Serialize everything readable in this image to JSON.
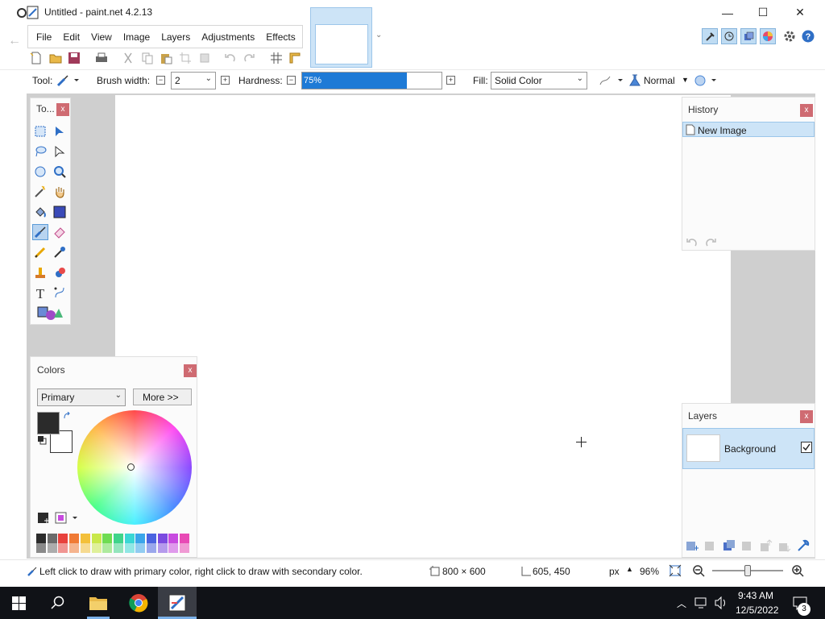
{
  "window": {
    "title": "Untitled - paint.net 4.2.13",
    "minimize": "—",
    "maximize": "☐",
    "close": "✕"
  },
  "menu": [
    "File",
    "Edit",
    "View",
    "Image",
    "Layers",
    "Adjustments",
    "Effects"
  ],
  "toolbar": {
    "tool_label": "Tool:",
    "brush_width_label": "Brush width:",
    "brush_width_value": "2",
    "hardness_label": "Hardness:",
    "hardness_value": "75%",
    "hardness_fraction": 0.75,
    "fill_label": "Fill:",
    "fill_value": "Solid Color",
    "blend_mode": "Normal"
  },
  "tools_panel": {
    "title": "To...",
    "close": "x"
  },
  "history_panel": {
    "title": "History",
    "close": "x",
    "items": [
      "New Image"
    ]
  },
  "layers_panel": {
    "title": "Layers",
    "close": "x",
    "items": [
      {
        "name": "Background",
        "visible": true
      }
    ]
  },
  "colors_panel": {
    "title": "Colors",
    "close": "x",
    "mode": "Primary",
    "more_button": "More >>",
    "primary_color": "#2b2b2b",
    "secondary_color": "#ffffff"
  },
  "palette": [
    "#2b2b2b",
    "#6b6b6b",
    "#e8413c",
    "#f07a35",
    "#f3c03a",
    "#c9e84a",
    "#6fdc52",
    "#3fd48a",
    "#3ad7d4",
    "#3aa5ea",
    "#4a63e0",
    "#7b4ae0",
    "#c84ae0",
    "#e84ab5"
  ],
  "status": {
    "hint": "Left click to draw with primary color, right click to draw with secondary color.",
    "image_size": "800 × 600",
    "cursor_pos": "605, 450",
    "units": "px",
    "zoom": "96%"
  },
  "taskbar": {
    "time": "9:43 AM",
    "date": "12/5/2022",
    "notification_count": "3"
  }
}
